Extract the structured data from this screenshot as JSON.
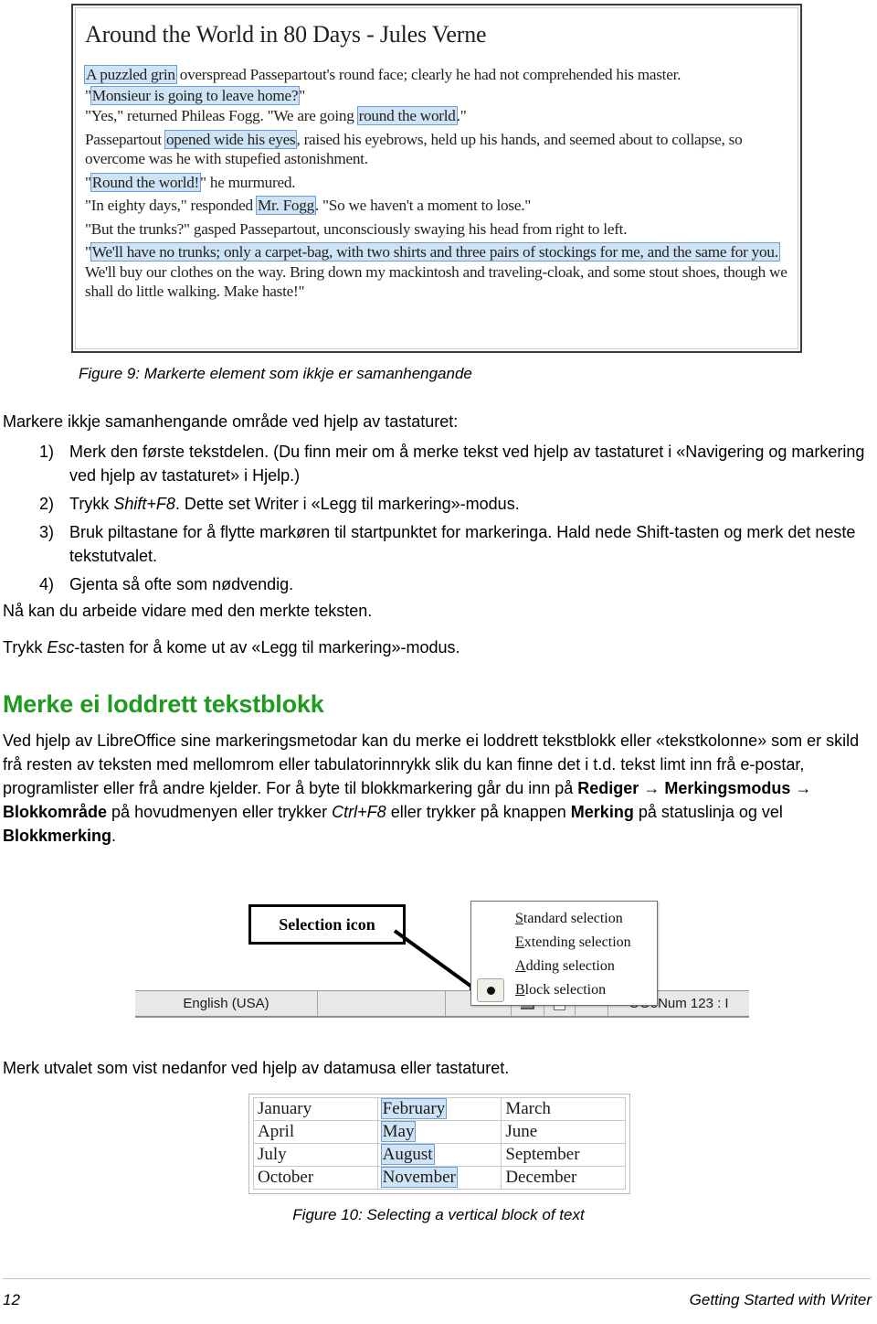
{
  "figure9": {
    "title": "Around the World in 80 Days - Jules Verne",
    "paragraphs": [
      {
        "id": "p1",
        "segments": [
          {
            "text": "A puzzled grin",
            "hl": true
          },
          {
            "text": " overspread Passepartout's round face; clearly he had not comprehended his master.",
            "hl": false
          }
        ]
      },
      {
        "id": "p2",
        "segments": [
          {
            "text": "\"",
            "hl": false
          },
          {
            "text": "Monsieur is going to leave home?",
            "hl": true
          },
          {
            "text": "\"",
            "hl": false
          }
        ]
      },
      {
        "id": "p3",
        "segments": [
          {
            "text": "\"Yes,\" returned Phileas Fogg. \"We are going ",
            "hl": false
          },
          {
            "text": "round the world",
            "hl": true
          },
          {
            "text": ".\"",
            "hl": false
          }
        ]
      },
      {
        "id": "p4",
        "segments": [
          {
            "text": "Passepartout ",
            "hl": false
          },
          {
            "text": "opened wide his eyes",
            "hl": true
          },
          {
            "text": ", raised his eyebrows, held up his hands, and seemed about to collapse, so overcome was he with stupefied astonishment.",
            "hl": false
          }
        ]
      },
      {
        "id": "p5",
        "segments": [
          {
            "text": "\"",
            "hl": false
          },
          {
            "text": "Round the world!",
            "hl": true
          },
          {
            "text": "\" he murmured.",
            "hl": false
          }
        ]
      },
      {
        "id": "p6",
        "segments": [
          {
            "text": "\"In eighty days,\" responded ",
            "hl": false
          },
          {
            "text": "Mr. Fogg",
            "hl": true
          },
          {
            "text": ". \"So we haven't a moment to lose.\"",
            "hl": false
          }
        ]
      },
      {
        "id": "p7",
        "segments": [
          {
            "text": "\"But the trunks?\" gasped Passepartout, unconsciously swaying his head from right to left.",
            "hl": false
          }
        ]
      },
      {
        "id": "p8",
        "segments": [
          {
            "text": "\"",
            "hl": false
          },
          {
            "text": "We'll have no trunks; only a carpet-bag, with two shirts and three pairs of stockings for me, and the same for you.",
            "hl": true
          },
          {
            "text": " We'll buy our clothes on the way. Bring down my mackintosh and traveling-cloak, and some stout shoes, though we shall do little walking. Make haste!\"",
            "hl": false
          }
        ]
      }
    ],
    "caption": "Figure 9: Markerte element som ikkje er samanhengande"
  },
  "intro": "Markere ikkje samanhengande område ved hjelp av tastaturet:",
  "steps": [
    {
      "num": "1)",
      "segments": [
        {
          "text": "Merk den første tekstdelen. (Du finn meir om å merke tekst ved hjelp av tastaturet i «Navigering og markering ved hjelp av tastaturet» i Hjelp.)",
          "style": "normal"
        }
      ]
    },
    {
      "num": "2)",
      "segments": [
        {
          "text": "Trykk ",
          "style": "normal"
        },
        {
          "text": "Shift+F8",
          "style": "italic"
        },
        {
          "text": ". Dette set Writer i «Legg til markering»-modus.",
          "style": "normal"
        }
      ]
    },
    {
      "num": "3)",
      "segments": [
        {
          "text": "Bruk piltastane for å flytte markøren til startpunktet for markeringa. Hald nede Shift-tasten og merk det neste tekstutvalet.",
          "style": "normal"
        }
      ]
    },
    {
      "num": "4)",
      "segments": [
        {
          "text": "Gjenta så ofte som nødvendig.",
          "style": "normal"
        }
      ]
    }
  ],
  "after_steps": {
    "line1": "Nå kan du arbeide vidare med den merkte teksten.",
    "line2_segments": [
      {
        "text": "Trykk ",
        "style": "normal"
      },
      {
        "text": "Esc",
        "style": "italic"
      },
      {
        "text": "-tasten for å kome ut av «Legg til markering»-modus.",
        "style": "normal"
      }
    ]
  },
  "section": {
    "heading": "Merke ei loddrett tekstblokk",
    "heading_color": "#1e9a1e",
    "body_segments": [
      {
        "text": "Ved hjelp av LibreOffice sine markeringsmetodar kan du merke ei loddrett tekstblokk eller «tekstkolonne» som er skild frå resten av teksten med mellomrom eller tabulatorinnrykk slik du kan finne det i t.d. tekst limt inn frå e-postar, programlister eller frå andre kjelder. For å byte til blokkmarkering går du inn på ",
        "style": "normal"
      },
      {
        "text": "Rediger",
        "style": "bold"
      },
      {
        "text": " → ",
        "style": "normal"
      },
      {
        "text": "Merkingsmodus",
        "style": "bold"
      },
      {
        "text": " → ",
        "style": "normal"
      },
      {
        "text": "Blokkområde",
        "style": "bold"
      },
      {
        "text": " på hovudmenyen eller trykker ",
        "style": "normal"
      },
      {
        "text": "Ctrl+F8",
        "style": "italic"
      },
      {
        "text": " eller trykker på knappen ",
        "style": "normal"
      },
      {
        "text": "Merking",
        "style": "bold"
      },
      {
        "text": " på statuslinja og vel ",
        "style": "normal"
      },
      {
        "text": "Blokkmerking",
        "style": "bold"
      },
      {
        "text": ".",
        "style": "normal"
      }
    ]
  },
  "selection_figure": {
    "callout_label": "Selection icon",
    "statusbar": {
      "language": "English (USA)",
      "right_text": "OOoNum 123 : I"
    },
    "dropdown": {
      "items": [
        {
          "mnemonic": "S",
          "rest": "tandard selection",
          "selected": false
        },
        {
          "mnemonic": "E",
          "rest": "xtending selection",
          "selected": false
        },
        {
          "mnemonic": "A",
          "rest": "dding selection",
          "selected": false
        },
        {
          "mnemonic": "B",
          "rest": "lock selection",
          "selected": true
        }
      ]
    }
  },
  "below_icon_text": "Merk utvalet som vist nedanfor ved hjelp av datamusa eller tastaturet.",
  "months_table": {
    "rows": [
      [
        {
          "text": "January",
          "selected": false
        },
        {
          "text": "February",
          "selected": true
        },
        {
          "text": "March",
          "selected": false
        }
      ],
      [
        {
          "text": "April",
          "selected": false
        },
        {
          "text": "May",
          "selected": true
        },
        {
          "text": "June",
          "selected": false
        }
      ],
      [
        {
          "text": "July",
          "selected": false
        },
        {
          "text": "August",
          "selected": true
        },
        {
          "text": "September",
          "selected": false
        }
      ],
      [
        {
          "text": "October",
          "selected": false
        },
        {
          "text": "November",
          "selected": true
        },
        {
          "text": "December",
          "selected": false
        }
      ]
    ],
    "highlight_color": "#cfe3f6",
    "highlight_border": "#6d9fd6"
  },
  "figure10_caption": "Figure 10: Selecting a vertical block of text",
  "footer": {
    "page_number": "12",
    "book_title": "Getting Started with Writer"
  }
}
